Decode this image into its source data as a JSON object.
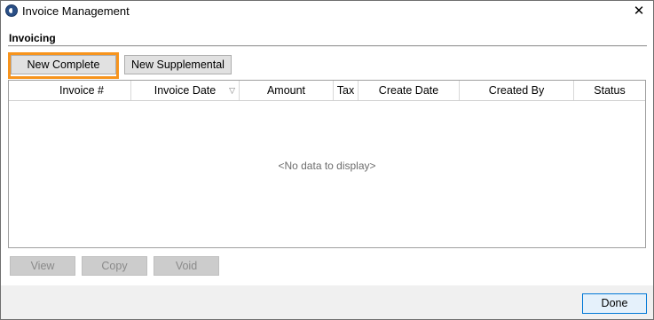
{
  "window": {
    "title": "Invoice Management",
    "close_label": "✕"
  },
  "section": {
    "title": "Invoicing"
  },
  "toolbar": {
    "new_complete_label": "New Complete",
    "new_supplemental_label": "New Supplemental"
  },
  "grid": {
    "columns": [
      "Invoice #",
      "Invoice Date",
      "Amount",
      "Tax",
      "Create Date",
      "Created By",
      "Status"
    ],
    "sort_indicator": "▽",
    "empty_message": "<No data to display>"
  },
  "actions": {
    "view_label": "View",
    "copy_label": "Copy",
    "void_label": "Void"
  },
  "footer": {
    "done_label": "Done"
  },
  "colors": {
    "highlight": "#f7941d",
    "done_border": "#0078d7"
  },
  "icons": {
    "app": "app-logo-icon",
    "close": "close-icon",
    "sort": "sort-descending-icon"
  }
}
